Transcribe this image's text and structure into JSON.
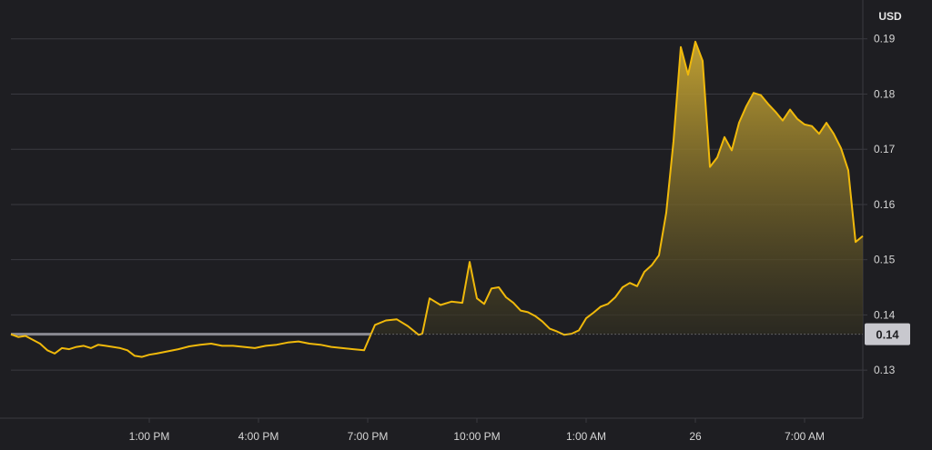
{
  "chart_data": {
    "type": "area",
    "unit": "USD",
    "x_tick_labels": [
      "1:00 PM",
      "4:00 PM",
      "7:00 PM",
      "10:00 PM",
      "1:00 AM",
      "26",
      "7:00 AM"
    ],
    "x_tick_hours": [
      1,
      4,
      7,
      10,
      13,
      16,
      19
    ],
    "y_ticks": [
      0.13,
      0.14,
      0.15,
      0.16,
      0.17,
      0.18,
      0.19
    ],
    "y_tick_labels": [
      "0.13",
      "0.14",
      "0.15",
      "0.16",
      "0.17",
      "0.18",
      "0.19"
    ],
    "ylim": [
      0.1213,
      0.1944
    ],
    "xlim_hours": [
      -2.8,
      20.6
    ],
    "reference_value": 0.1365,
    "current_price_label": "0.14",
    "grid": true,
    "colors": {
      "line": "#f0b90b",
      "reference_line": "#8a8a92",
      "grid": "#3a3a40",
      "badge": "#c8c8ce",
      "background": "#1e1e22"
    },
    "series": [
      {
        "x_hours": [
          -2.8,
          -2.6,
          -2.4,
          -2.2,
          -2.0,
          -1.8,
          -1.6,
          -1.4,
          -1.2,
          -1.0,
          -0.8,
          -0.6,
          -0.4,
          -0.2,
          0.0,
          0.2,
          0.4,
          0.6,
          0.8,
          1.0,
          1.2,
          1.5,
          1.8,
          2.1,
          2.4,
          2.7,
          3.0,
          3.3,
          3.6,
          3.9,
          4.2,
          4.5,
          4.8,
          5.1,
          5.4,
          5.7,
          6.0,
          6.3,
          6.6,
          6.9,
          7.2,
          7.5,
          7.8,
          8.1,
          8.4,
          8.5,
          8.7,
          9.0,
          9.3,
          9.6,
          9.8,
          10.0,
          10.2,
          10.4,
          10.6,
          10.8,
          11.0,
          11.2,
          11.4,
          11.6,
          11.8,
          12.0,
          12.2,
          12.4,
          12.6,
          12.8,
          13.0,
          13.2,
          13.4,
          13.6,
          13.8,
          14.0,
          14.2,
          14.4,
          14.6,
          14.8,
          15.0,
          15.2,
          15.4,
          15.6,
          15.8,
          16.0,
          16.2,
          16.4,
          16.6,
          16.8,
          17.0,
          17.2,
          17.4,
          17.6,
          17.8,
          18.0,
          18.2,
          18.4,
          18.6,
          18.8,
          19.0,
          19.2,
          19.4,
          19.6,
          19.8,
          20.0,
          20.2,
          20.4,
          20.6
        ],
        "values": [
          0.1365,
          0.136,
          0.1362,
          0.1355,
          0.1348,
          0.1336,
          0.133,
          0.134,
          0.1338,
          0.1342,
          0.1344,
          0.134,
          0.1346,
          0.1344,
          0.1342,
          0.134,
          0.1336,
          0.1326,
          0.1324,
          0.1328,
          0.133,
          0.1334,
          0.1338,
          0.1343,
          0.1346,
          0.1348,
          0.1344,
          0.1344,
          0.1342,
          0.134,
          0.1344,
          0.1346,
          0.135,
          0.1352,
          0.1348,
          0.1346,
          0.1342,
          0.134,
          0.1338,
          0.1336,
          0.1382,
          0.139,
          0.1392,
          0.138,
          0.1364,
          0.1366,
          0.143,
          0.1418,
          0.1424,
          0.1422,
          0.1496,
          0.143,
          0.142,
          0.1448,
          0.145,
          0.1432,
          0.1422,
          0.1408,
          0.1405,
          0.1398,
          0.1388,
          0.1375,
          0.137,
          0.1364,
          0.1366,
          0.1372,
          0.1394,
          0.1404,
          0.1415,
          0.142,
          0.1432,
          0.145,
          0.1458,
          0.1452,
          0.1478,
          0.149,
          0.1508,
          0.1585,
          0.1715,
          0.1885,
          0.1835,
          0.1895,
          0.186,
          0.1668,
          0.1685,
          0.1722,
          0.1698,
          0.1748,
          0.1778,
          0.1802,
          0.1798,
          0.1782,
          0.1768,
          0.1752,
          0.1772,
          0.1755,
          0.1745,
          0.1742,
          0.1728,
          0.1748,
          0.1728,
          0.1702,
          0.1662,
          0.1532,
          0.1543
        ]
      }
    ]
  }
}
